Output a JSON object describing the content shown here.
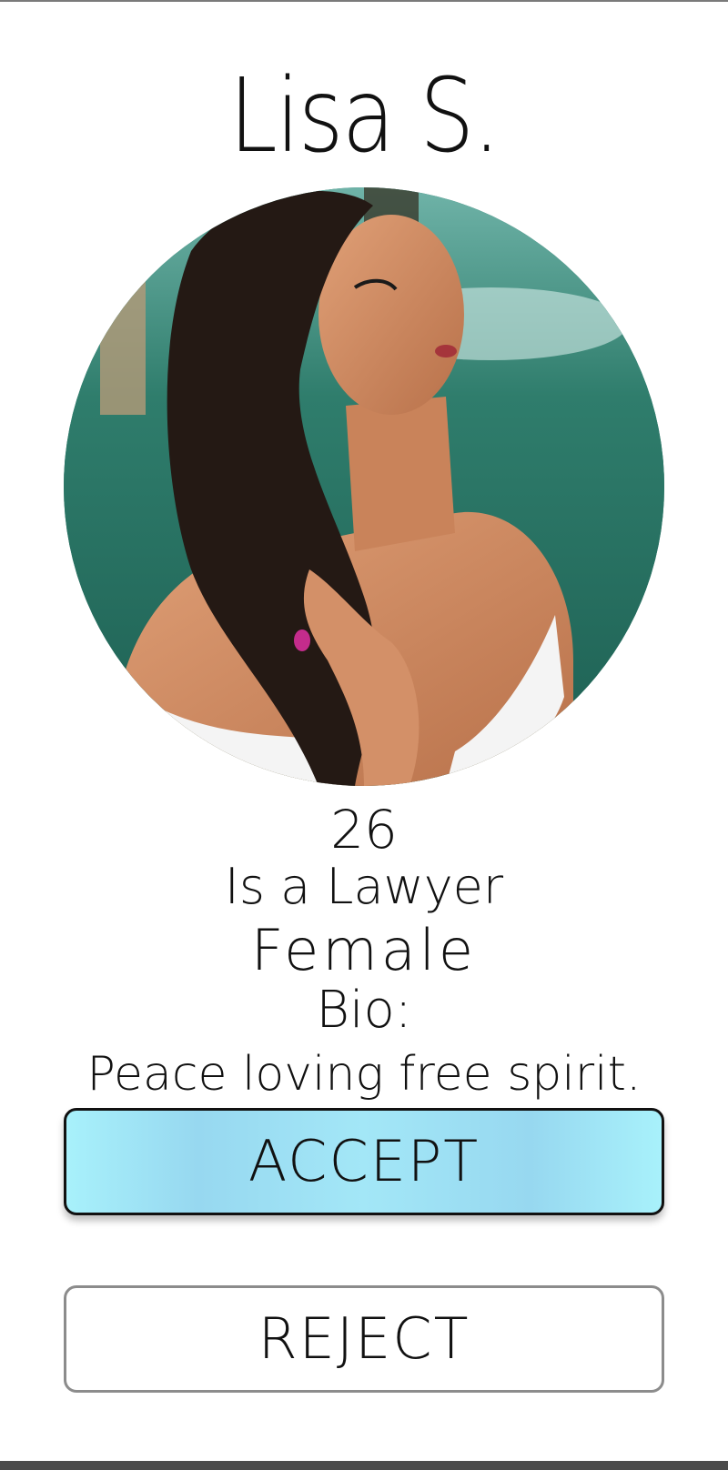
{
  "profile": {
    "name": "Lisa S.",
    "age": "26",
    "occupation": "Is a Lawyer",
    "gender": "Female",
    "bio_label": "Bio:",
    "bio_text": "Peace loving free spirit."
  },
  "actions": {
    "accept_label": "ACCEPT",
    "reject_label": "REJECT"
  },
  "colors": {
    "accept_fill": "#a3e7f7",
    "accept_border": "#111111",
    "reject_border": "#8c8c8c",
    "background": "#ffffff"
  }
}
